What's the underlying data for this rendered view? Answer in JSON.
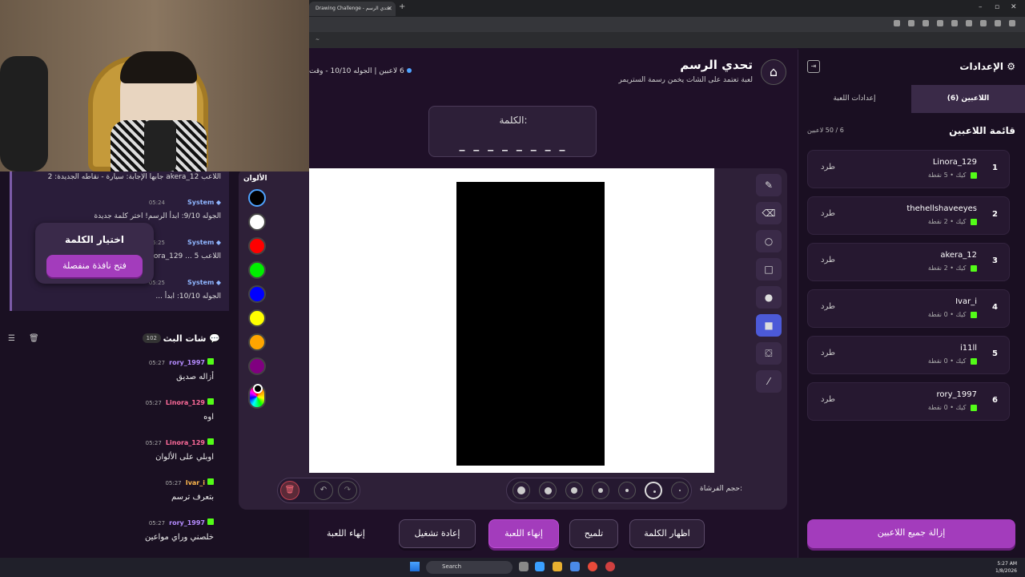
{
  "browser": {
    "tab_title": "Drawing Challenge - تحدي الرسم",
    "bookmark": "~"
  },
  "stream_chat_system": [
    {
      "name": "",
      "time": "",
      "text": "اللاعب akera_12 جابها الإجابة: سيارة - نقاطه الجديدة: 2"
    },
    {
      "name": "System",
      "time": "05:24",
      "text": "الجوله 9/10: ابدأ الرسم! اختر كلمة جديدة"
    },
    {
      "name": "System",
      "time": "05:25",
      "text": "اللاعب Linora_129 ... 5"
    },
    {
      "name": "System",
      "time": "05:25",
      "text": "الجوله 10/10: ابدأ ..."
    }
  ],
  "word_picker": {
    "title": "اختيار الكلمة",
    "button": "فتح نافذة منفصلة"
  },
  "chat": {
    "title": "شات البث",
    "count": "102",
    "messages": [
      {
        "user": "rory_1997",
        "time": "05:27",
        "text": "أزاله صديق",
        "color": "#b58cff"
      },
      {
        "user": "Linora_129",
        "time": "05:27",
        "text": "اوه",
        "color": "#ff6b9a"
      },
      {
        "user": "Linora_129",
        "time": "05:27",
        "text": "اوبلي على الألوان",
        "color": "#ff6b9a"
      },
      {
        "user": "Ivar_i",
        "time": "05:27",
        "text": "بتعرف ترسم",
        "color": "#ffb84d"
      },
      {
        "user": "rory_1997",
        "time": "05:27",
        "text": "خلصني وراي مواعين",
        "color": "#b58cff"
      }
    ]
  },
  "app": {
    "title": "تحدي الرسم",
    "subtitle": "لعبة تعتمد على الشات يخمن رسمة الستريمر",
    "stats": "6 لاعبين | الجوله 10/10 - وقت",
    "word_label": "الكلمة:",
    "word_mask": "_ _ _ _ _ _ _ _",
    "colors_label": "الألوان",
    "colors": [
      "#000000",
      "#ffffff",
      "#ff0000",
      "#00ee00",
      "#0000ff",
      "#ffff00",
      "#ffa500",
      "#800080"
    ],
    "brush_label": "حجم الفرشاة:",
    "tools": [
      "pencil-icon",
      "eraser-icon",
      "circle-outline-icon",
      "rectangle-outline-icon",
      "circle-fill-icon",
      "rectangle-fill-icon",
      "fill-bucket-icon",
      "line-icon"
    ],
    "buttons": {
      "show_word": "اظهار الكلمة",
      "hint": "تلميح",
      "end_game": "إنهاء اللعبة",
      "restart": "إعادة تشغيل",
      "end_game_text": "إنهاء اللعبة"
    }
  },
  "settings": {
    "title": "الإعدادات",
    "tab_players": "اللاعبين (6)",
    "tab_game": "إعدادات اللعبة",
    "players_title": "قائمة اللاعبين",
    "players_count": "6 / 50 لاعبين",
    "kick_label": "طرد",
    "remove_all": "إزالة جميع اللاعبين",
    "players": [
      {
        "rank": "1",
        "name": "Linora_129",
        "meta": "كيك • 5 نقطة"
      },
      {
        "rank": "2",
        "name": "thehellshaveeyes",
        "meta": "كيك • 2 نقطة"
      },
      {
        "rank": "3",
        "name": "akera_12",
        "meta": "كيك • 2 نقطة"
      },
      {
        "rank": "4",
        "name": "Ivar_i",
        "meta": "كيك • 0 نقطة"
      },
      {
        "rank": "5",
        "name": "i11ll",
        "meta": "كيك • 0 نقطة"
      },
      {
        "rank": "6",
        "name": "rory_1997",
        "meta": "كيك • 0 نقطة"
      }
    ]
  },
  "taskbar": {
    "search": "Search",
    "time": "5:27 AM",
    "date": "1/8/2026"
  }
}
